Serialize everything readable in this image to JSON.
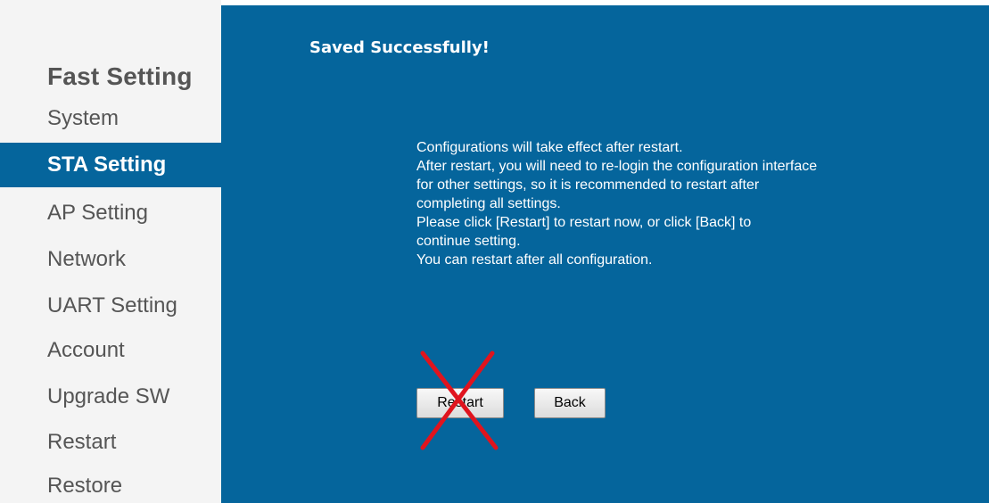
{
  "sidebar": {
    "title": "Fast Setting",
    "items": [
      {
        "label": "System"
      },
      {
        "label": "STA Setting",
        "active": true
      },
      {
        "label": "AP Setting"
      },
      {
        "label": "Network"
      },
      {
        "label": "UART Setting"
      },
      {
        "label": "Account"
      },
      {
        "label": "Upgrade SW"
      },
      {
        "label": "Restart"
      },
      {
        "label": "Restore"
      }
    ]
  },
  "main": {
    "heading": "Saved Successfully!",
    "message_lines": [
      "Configurations will take effect after restart.",
      "After restart, you will need to re-login the configuration interface",
      "for other settings, so it is recommended to restart after",
      "completing all settings.",
      "Please click [Restart] to restart now, or click [Back] to",
      "continue setting.",
      "You can restart after all configuration."
    ],
    "buttons": {
      "restart_label": "Restart",
      "back_label": "Back"
    }
  },
  "overlay": {
    "cross_icon": "x-mark-icon",
    "cross_color": "#e0141e"
  },
  "colors": {
    "accent": "#05659c",
    "sidebar_bg": "#f4f4f4",
    "sidebar_text": "#555555"
  }
}
